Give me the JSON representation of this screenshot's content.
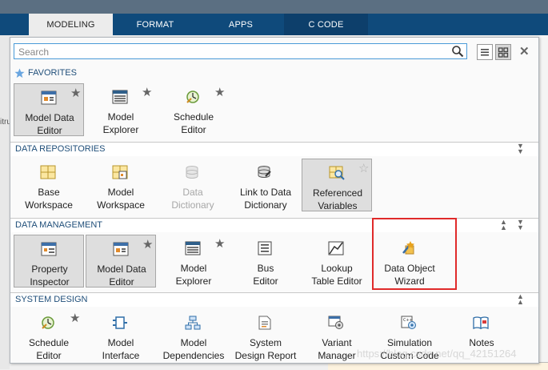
{
  "tabs": [
    {
      "label": "MODELING",
      "state": "active"
    },
    {
      "label": "FORMAT",
      "state": "normal"
    },
    {
      "label": "APPS",
      "state": "normal"
    },
    {
      "label": "C CODE",
      "state": "normal"
    }
  ],
  "background_text": "itru",
  "search": {
    "placeholder": "Search"
  },
  "sections": {
    "favorites": {
      "title": "FAVORITES"
    },
    "data_repositories": {
      "title": "DATA REPOSITORIES"
    },
    "data_management": {
      "title": "DATA MANAGEMENT"
    },
    "system_design": {
      "title": "SYSTEM DESIGN"
    }
  },
  "favorites_items": [
    {
      "line1": "Model Data",
      "line2": "Editor",
      "icon": "model-data-editor-icon",
      "favorite": true,
      "selected": true
    },
    {
      "line1": "Model",
      "line2": "Explorer",
      "icon": "model-explorer-icon",
      "favorite": true
    },
    {
      "line1": "Schedule",
      "line2": "Editor",
      "icon": "schedule-editor-icon",
      "favorite": true
    }
  ],
  "data_repositories_items": [
    {
      "line1": "Base",
      "line2": "Workspace",
      "icon": "base-workspace-icon"
    },
    {
      "line1": "Model",
      "line2": "Workspace",
      "icon": "model-workspace-icon"
    },
    {
      "line1": "Data",
      "line2": "Dictionary",
      "icon": "data-dictionary-icon",
      "disabled": true
    },
    {
      "line1": "Link to Data",
      "line2": "Dictionary",
      "icon": "link-data-dictionary-icon"
    },
    {
      "line1": "Referenced",
      "line2": "Variables",
      "icon": "referenced-variables-icon",
      "selected": true,
      "favorite_outline": true
    }
  ],
  "data_management_items": [
    {
      "line1": "Property",
      "line2": "Inspector",
      "icon": "property-inspector-icon",
      "selected": true
    },
    {
      "line1": "Model Data",
      "line2": "Editor",
      "icon": "model-data-editor-icon",
      "favorite": true,
      "selected": true
    },
    {
      "line1": "Model",
      "line2": "Explorer",
      "icon": "model-explorer-icon",
      "favorite": true
    },
    {
      "line1": "Bus",
      "line2": "Editor",
      "icon": "bus-editor-icon"
    },
    {
      "line1": "Lookup",
      "line2": "Table Editor",
      "icon": "lookup-table-editor-icon"
    },
    {
      "line1": "Data Object",
      "line2": "Wizard",
      "icon": "data-object-wizard-icon"
    }
  ],
  "system_design_items": [
    {
      "line1": "Schedule",
      "line2": "Editor",
      "icon": "schedule-editor-icon",
      "favorite": true
    },
    {
      "line1": "Model",
      "line2": "Interface",
      "icon": "model-interface-icon"
    },
    {
      "line1": "Model",
      "line2": "Dependencies",
      "icon": "model-dependencies-icon"
    },
    {
      "line1": "System",
      "line2": "Design Report",
      "icon": "system-design-report-icon"
    },
    {
      "line1": "Variant",
      "line2": "Manager",
      "icon": "variant-manager-icon"
    },
    {
      "line1": "Simulation",
      "line2": "Custom Code",
      "icon": "simulation-custom-code-icon"
    },
    {
      "line1": "Notes",
      "line2": "",
      "icon": "notes-icon"
    }
  ],
  "watermark": "https://blog.csdn.net/qq_42151264",
  "colors": {
    "tabbar": "#0f4a7b",
    "section_title": "#1f4e79",
    "highlight": "#e02a2a",
    "search_border": "#4a9bd8"
  }
}
